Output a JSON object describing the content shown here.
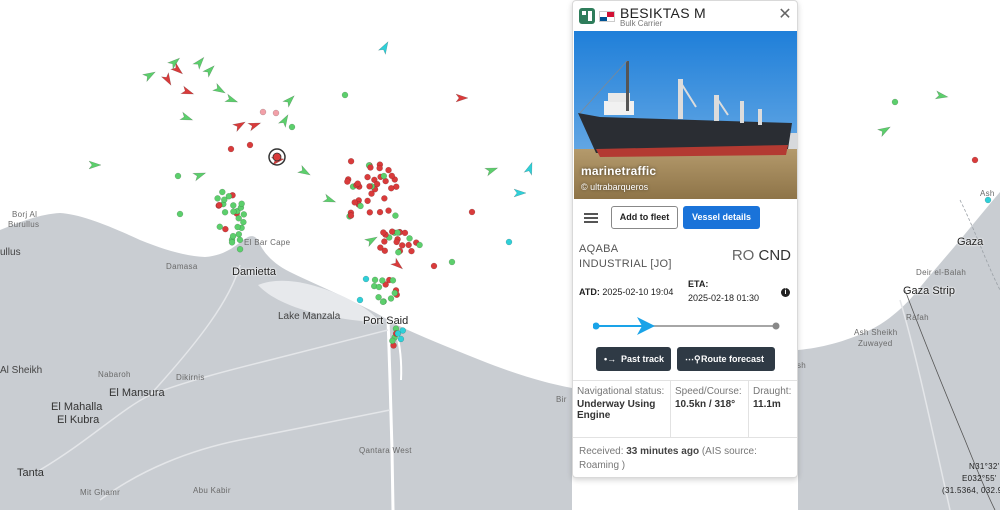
{
  "map": {
    "labels": [
      {
        "key": "borj",
        "text": "Borj Al"
      },
      {
        "key": "burullus",
        "text": "Burullus"
      },
      {
        "key": "ullus",
        "text": "ullus"
      },
      {
        "key": "elbar",
        "text": "El Bar Cape"
      },
      {
        "key": "damasa",
        "text": "Damasa"
      },
      {
        "key": "damietta",
        "text": "Damietta"
      },
      {
        "key": "manzala",
        "text": "Lake Manzala"
      },
      {
        "key": "portsaid",
        "text": "Port Said"
      },
      {
        "key": "alsheikh",
        "text": "Al Sheikh"
      },
      {
        "key": "nabaroh",
        "text": "Nabaroh"
      },
      {
        "key": "dikirnis",
        "text": "Dikirnis"
      },
      {
        "key": "mansura",
        "text": "El Mansura"
      },
      {
        "key": "mahalla1",
        "text": "El Mahalla"
      },
      {
        "key": "mahalla2",
        "text": "El Kubra"
      },
      {
        "key": "tanta",
        "text": "Tanta"
      },
      {
        "key": "mitghamr",
        "text": "Mit Ghamr"
      },
      {
        "key": "abukabir",
        "text": "Abu Kabir"
      },
      {
        "key": "qantara",
        "text": "Qantara West"
      },
      {
        "key": "bir",
        "text": "Bir"
      },
      {
        "key": "gaza",
        "text": "Gaza"
      },
      {
        "key": "deir",
        "text": "Deir el-Balah"
      },
      {
        "key": "gazastrip",
        "text": "Gaza Strip"
      },
      {
        "key": "rafah",
        "text": "Rafah"
      },
      {
        "key": "ashsheikh",
        "text": "Ash Sheikh"
      },
      {
        "key": "zuwayed",
        "text": "Zuwayed"
      },
      {
        "key": "ash",
        "text": "Ash"
      },
      {
        "key": "coord1",
        "text": "N31°32'"
      },
      {
        "key": "coord2",
        "text": "E032°55'"
      },
      {
        "key": "coord3",
        "text": "(31.5364, 032.9"
      },
      {
        "key": "sh",
        "text": "sh"
      }
    ],
    "colors": {
      "sea": "#ffffff",
      "land": "#c9cdd2",
      "lake": "#e7e9ec",
      "cargo_red": "#d93b3b",
      "tanker_green": "#5ccf6c",
      "passenger_cyan": "#2fd0d8",
      "unknown_pink": "#f2a0a8"
    }
  },
  "vessel": {
    "name": "BESIKTAS M",
    "type": "Bulk Carrier",
    "flag": "Panama",
    "close_icon": "close-icon",
    "photo_brand": "marinetraffic",
    "photo_credit": "© ultrabarqueros",
    "add_to_fleet": "Add to fleet",
    "vessel_details": "Vessel details",
    "menu_icon": "hamburger-icon",
    "destination_line1": "AQABA",
    "destination_line2": "INDUSTRIAL [JO]",
    "ro_prefix": "RO",
    "ro_code": "CND",
    "atd_label": "ATD:",
    "atd_value": "2025-02-10 19:04",
    "eta_label": "ETA:",
    "eta_value": "2025-02-18 01:30",
    "info_icon": "info-icon",
    "past_track": "Past track",
    "route_forecast": "Route forecast",
    "nav_status_label": "Navigational status:",
    "nav_status_value": "Underway Using Engine",
    "speed_label": "Speed/Course:",
    "speed_value": "10.5kn / 318°",
    "draught_label": "Draught:",
    "draught_value": "11.1m",
    "received_prefix": "Received:",
    "received_value": "33 minutes ago",
    "received_suffix": "(AIS source: Roaming )",
    "accent_color": "#1a73d9",
    "track_color": "#1aa3e8"
  }
}
